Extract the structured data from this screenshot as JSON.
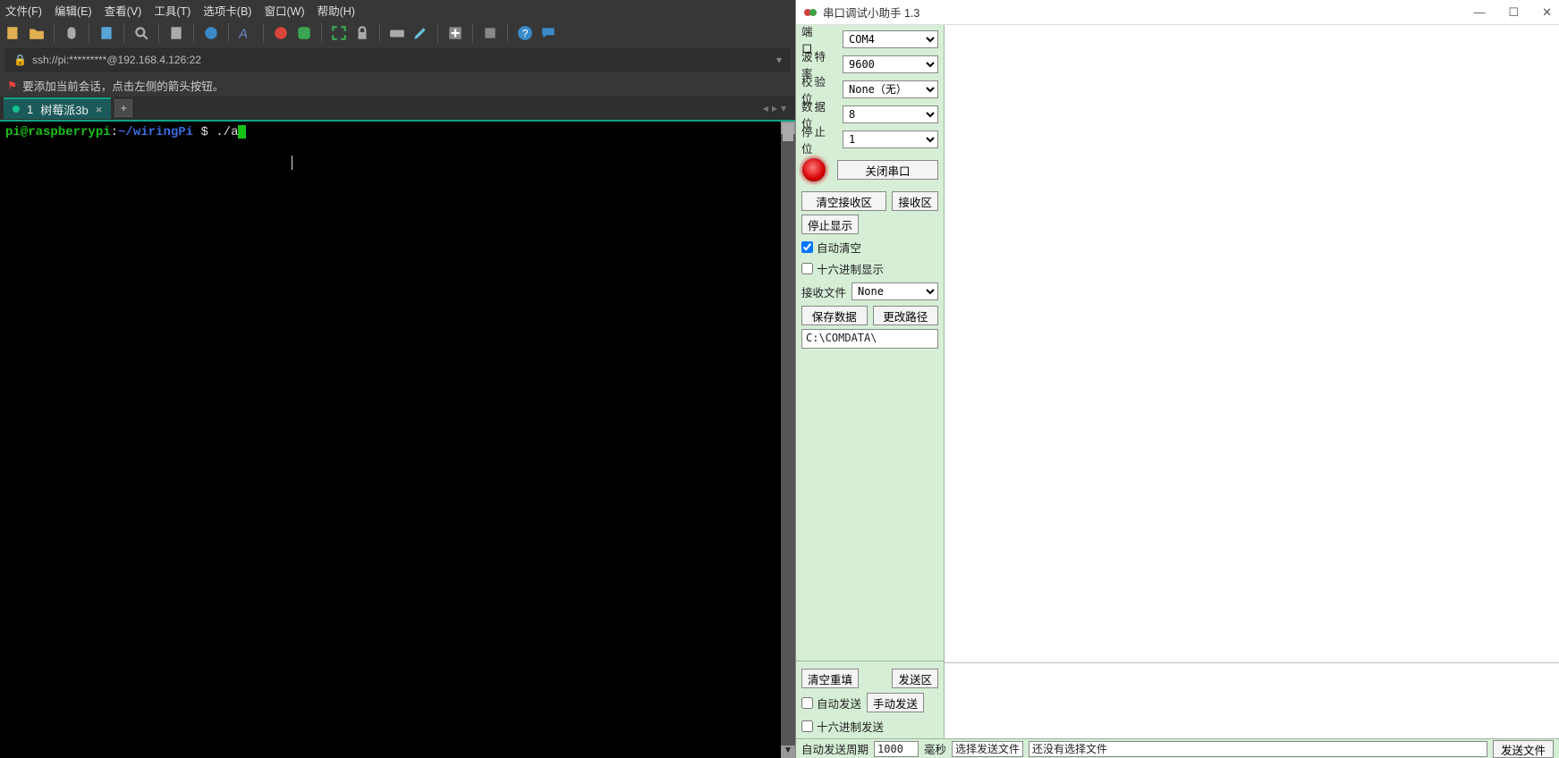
{
  "left": {
    "menubar": [
      "文件(F)",
      "编辑(E)",
      "查看(V)",
      "工具(T)",
      "选项卡(B)",
      "窗口(W)",
      "帮助(H)"
    ],
    "address": "ssh://pi:*********@192.168.4.126:22",
    "hint": "要添加当前会话，点击左侧的箭头按钮。",
    "tab": {
      "index": "1",
      "name": "树莓派3b"
    },
    "prompt": {
      "user": "pi@raspberrypi",
      "sep1": ":",
      "path": "~/wiringPi",
      "sep2": " $ ",
      "cmd": "./a"
    }
  },
  "right": {
    "title": "串口调试小助手 1.3",
    "panel": {
      "port_lbl": "端　口",
      "baud_lbl": "波特率",
      "parity_lbl": "校验位",
      "data_lbl": "数据位",
      "stop_lbl": "停止位",
      "port_val": "COM4",
      "baud_val": "9600",
      "parity_val": "None（无）",
      "data_val": "8",
      "stop_val": "1",
      "btn_closeport": "关闭串口",
      "btn_clearrx": "清空接收区",
      "btn_rxarea": "接收区",
      "btn_stopdisp": "停止显示",
      "chk_autoclear": "自动清空",
      "chk_hexdisp": "十六进制显示",
      "recvfile_lbl": "接收文件",
      "recvfile_val": "None",
      "btn_savedata": "保存数据",
      "btn_chgpath": "更改路径",
      "path_val": "C:\\COMDATA\\",
      "btn_cleartpl": "清空重填",
      "btn_txarea": "发送区",
      "chk_autosend": "自动发送",
      "btn_manualsend": "手动发送",
      "chk_hexsend": "十六进制发送"
    },
    "footer": {
      "autoperiod_lbl": "自动发送周期",
      "autoperiod_val": "1000",
      "ms_lbl": "毫秒",
      "pickfile_lbl": "选择发送文件",
      "nofile_lbl": "还没有选择文件",
      "btn_sendfile": "发送文件"
    }
  }
}
